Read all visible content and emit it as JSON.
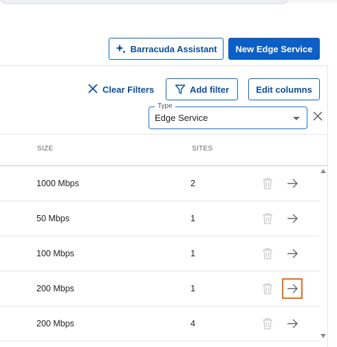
{
  "toolbar": {
    "assistant_label": "Barracuda Assistant",
    "new_service_label": "New Edge Service"
  },
  "filters": {
    "clear_label": "Clear Filters",
    "add_label": "Add filter",
    "edit_columns_label": "Edit columns",
    "type_legend": "Type",
    "type_value": "Edge Service"
  },
  "table": {
    "columns": {
      "size": "SIZE",
      "sites": "SITES"
    },
    "rows": [
      {
        "size": "1000 Mbps",
        "sites": "2"
      },
      {
        "size": "50 Mbps",
        "sites": "1"
      },
      {
        "size": "100 Mbps",
        "sites": "1"
      },
      {
        "size": "200 Mbps",
        "sites": "1"
      },
      {
        "size": "200 Mbps",
        "sites": "4"
      }
    ]
  },
  "colors": {
    "primary": "#0b5fc7",
    "highlight": "#ec6a12"
  }
}
